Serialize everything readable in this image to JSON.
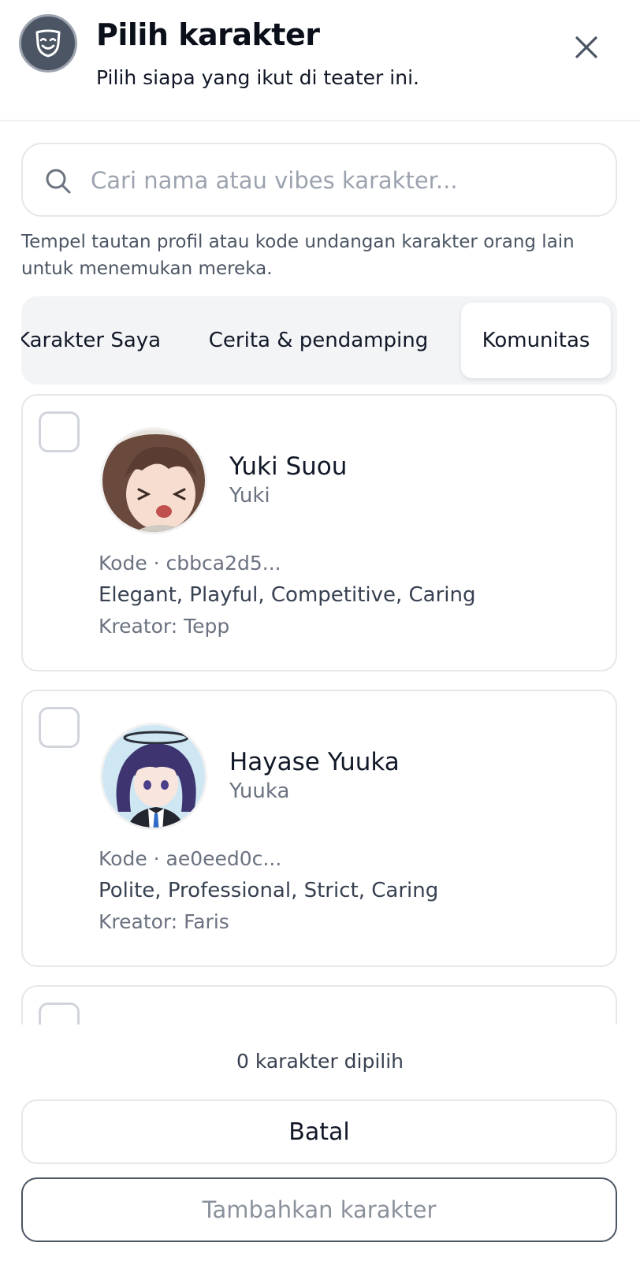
{
  "header": {
    "icon": "theater-mask-icon",
    "title": "Pilih karakter",
    "subtitle": "Pilih siapa yang ikut di teater ini.",
    "close_icon": "close-icon"
  },
  "search": {
    "placeholder": "Cari nama atau vibes karakter...",
    "value": "",
    "hint": "Tempel tautan profil atau kode undangan karakter orang lain untuk menemukan mereka."
  },
  "tabs": [
    {
      "label": "Karakter Saya",
      "active": false
    },
    {
      "label": "Cerita & pendamping",
      "active": false
    },
    {
      "label": "Komunitas",
      "active": true
    }
  ],
  "characters": [
    {
      "name": "Yuki Suou",
      "short_name": "Yuki",
      "code": "Kode · cbbca2d5...",
      "traits": "Elegant, Playful, Competitive, Caring",
      "creator": "Kreator: Tepp",
      "selected": false
    },
    {
      "name": "Hayase Yuuka",
      "short_name": "Yuuka",
      "code": "Kode · ae0eed0c...",
      "traits": "Polite, Professional, Strict, Caring",
      "creator": "Kreator: Faris",
      "selected": false
    }
  ],
  "footer": {
    "selected_count": "0 karakter dipilih",
    "cancel_label": "Batal",
    "add_label": "Tambahkan karakter"
  },
  "colors": {
    "accent_dark": "#4b5563",
    "muted_text": "#6b7280",
    "border": "#e5e7eb"
  }
}
